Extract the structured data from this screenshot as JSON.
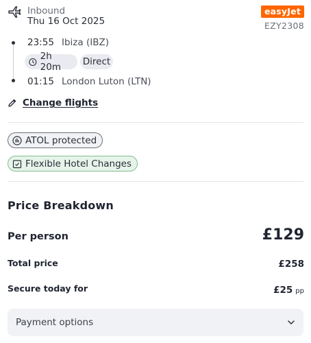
{
  "flight": {
    "direction": "Inbound",
    "date": "Thu 16 Oct 2025",
    "airline_logo": "easyJet",
    "flight_number": "EZY2308",
    "departure": {
      "time": "23:55",
      "place": "Ibiza (IBZ)"
    },
    "arrival": {
      "time": "01:15",
      "place": "London Luton (LTN)"
    },
    "duration": "2h 20m",
    "stops": "Direct",
    "change_link": "Change flights"
  },
  "badges": {
    "atol": "ATOL protected",
    "hotel": "Flexible Hotel Changes"
  },
  "price": {
    "title": "Price Breakdown",
    "per_person_label": "Per person",
    "per_person_value": "£129",
    "total_label": "Total price",
    "total_value": "£258",
    "secure_label": "Secure today for",
    "secure_value": "£25",
    "secure_suffix": "pp"
  },
  "payment": {
    "label": "Payment options"
  },
  "colors": {
    "brand": "#ff6600",
    "chip_bg": "#eaebf0",
    "hotel_badge_bg": "#e6f4ea"
  },
  "icons": [
    "plane-landing-icon",
    "clock-icon",
    "pencil-icon",
    "atol-icon",
    "calendar-check-icon",
    "chevron-down-icon"
  ]
}
